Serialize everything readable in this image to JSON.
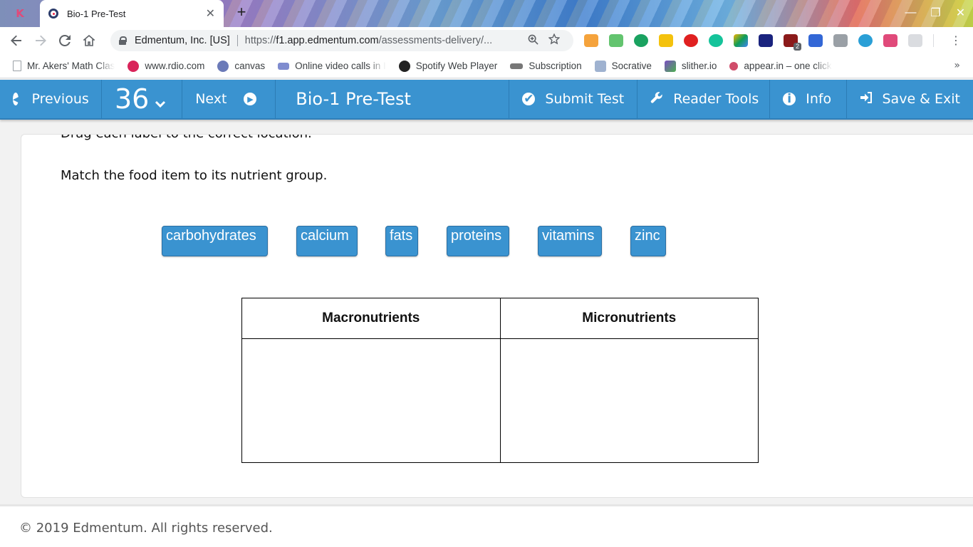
{
  "browser": {
    "tab_title": "Bio-1 Pre-Test",
    "tab_close": "✕",
    "new_tab": "+",
    "window_controls": {
      "minimize": "—",
      "restore": "❐",
      "close": "✕"
    },
    "site_name": "Edmentum, Inc. [US]",
    "url_scheme": "https://",
    "url_host": "f1.app.edmentum.com",
    "url_path": "/assessments-delivery/...",
    "bookmarks": [
      {
        "label": "Mr. Akers' Math Clas",
        "icon_color": "#9aa0a6"
      },
      {
        "label": "www.rdio.com",
        "icon_color": "#d9245a"
      },
      {
        "label": "canvas",
        "icon_color": "#6b7ab8"
      },
      {
        "label": "Online video calls in I",
        "icon_color": "#7f8ccf"
      },
      {
        "label": "Spotify Web Player",
        "icon_color": "#222222"
      },
      {
        "label": "Subscription",
        "icon_color": "#777777"
      },
      {
        "label": "Socrative",
        "icon_color": "#9fb2d0"
      },
      {
        "label": "slither.io",
        "icon_color": "#7b4cc2"
      },
      {
        "label": "appear.in – one click",
        "icon_color": "#d04d6a"
      }
    ],
    "bookmarks_more": "»",
    "extension_badge": "2"
  },
  "appbar": {
    "previous_label": "Previous",
    "question_number": "36",
    "next_label": "Next",
    "test_title": "Bio-1 Pre-Test",
    "submit_label": "Submit Test",
    "reader_tools_label": "Reader Tools",
    "info_label": "Info",
    "save_exit_label": "Save & Exit"
  },
  "question": {
    "instruction": "Drag each label to the correct location.",
    "prompt": "Match the food item to its nutrient group.",
    "labels": [
      "carbohydrates",
      "calcium",
      "fats",
      "proteins",
      "vitamins",
      "zinc"
    ],
    "columns": [
      "Macronutrients",
      "Micronutrients"
    ]
  },
  "footer": {
    "copyright": "© 2019 Edmentum. All rights reserved."
  },
  "colors": {
    "accent": "#3a93d0",
    "label_bg": "#3a93d0"
  }
}
